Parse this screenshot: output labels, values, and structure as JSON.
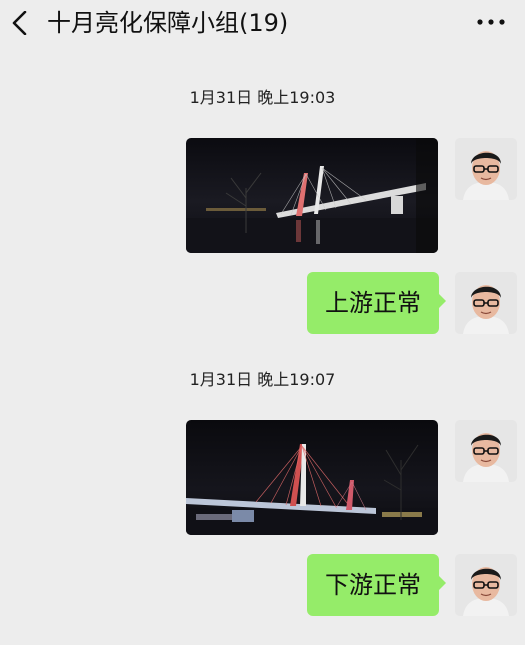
{
  "header": {
    "title": "十月亮化保障小组(19)",
    "back_icon": "chevron-left-icon",
    "more_icon": "more-dots-icon"
  },
  "messages": [
    {
      "timestamp": "1月31日 晚上19:03",
      "type": "image",
      "description_icon": "photo-thumbnail"
    },
    {
      "type": "text",
      "text": "上游正常"
    },
    {
      "timestamp": "1月31日 晚上19:07",
      "type": "image",
      "description_icon": "photo-thumbnail"
    },
    {
      "type": "text",
      "text": "下游正常"
    }
  ],
  "colors": {
    "background": "#ededed",
    "bubble": "#95ec69"
  }
}
